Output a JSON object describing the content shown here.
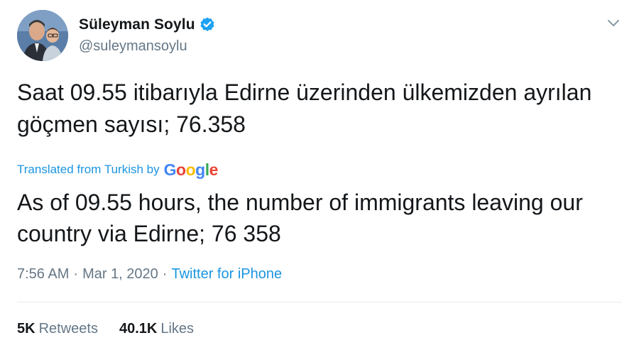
{
  "author": {
    "display_name": "Süleyman Soylu",
    "handle": "@suleymansoylu",
    "verified": true
  },
  "tweet": {
    "text": "Saat 09.55 itibarıyla Edirne üzerinden ülkemizden ayrılan göçmen sayısı; 76.358",
    "translation_label": "Translated from Turkish by",
    "translation_provider": "Google",
    "translated_text": "As of 09.55 hours, the number of immigrants leaving our country via Edirne; 76 358",
    "time": "7:56 AM",
    "separator": "·",
    "date": "Mar 1, 2020",
    "source": "Twitter for iPhone"
  },
  "stats": {
    "retweets_count": "5K",
    "retweets_label": "Retweets",
    "likes_count": "40.1K",
    "likes_label": "Likes"
  },
  "icons": {
    "verified": "verified-badge-icon",
    "caret": "chevron-down-icon"
  },
  "colors": {
    "link": "#1b95e0",
    "secondary_text": "#657786",
    "primary_text": "#14171a",
    "verified_badge": "#1da1f2",
    "divider": "#e6ecf0"
  }
}
